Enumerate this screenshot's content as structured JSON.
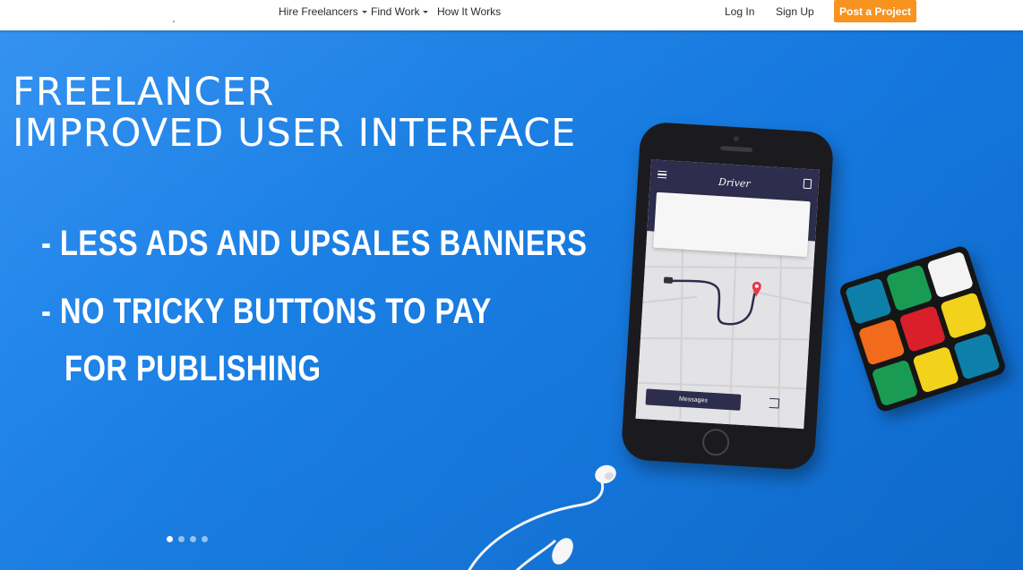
{
  "nav": {
    "links": [
      {
        "label": "Hire Freelancers",
        "dropdown": true
      },
      {
        "label": "Find Work",
        "dropdown": true
      },
      {
        "label": "How It Works",
        "dropdown": false
      }
    ],
    "login": "Log In",
    "signup": "Sign Up",
    "post_project": "Post a Project",
    "accent_color": "#f7931e"
  },
  "hero": {
    "title_line1": "FREELANCER",
    "title_line2": "IMPROVED USER INTERFACE",
    "bullet1": "- LESS ADS AND UPSALES BANNERS",
    "bullet2": "- NO TRICKY BUTTONS TO PAY",
    "bullet3": "FOR PUBLISHING",
    "background_color": "#1a7ee0",
    "carousel": {
      "count": 4,
      "active_index": 0
    }
  },
  "phone": {
    "app_title": "Driver",
    "messages_label": "Messages",
    "icons": [
      "menu-icon",
      "document-icon",
      "map-pin-icon",
      "exit-icon"
    ]
  }
}
